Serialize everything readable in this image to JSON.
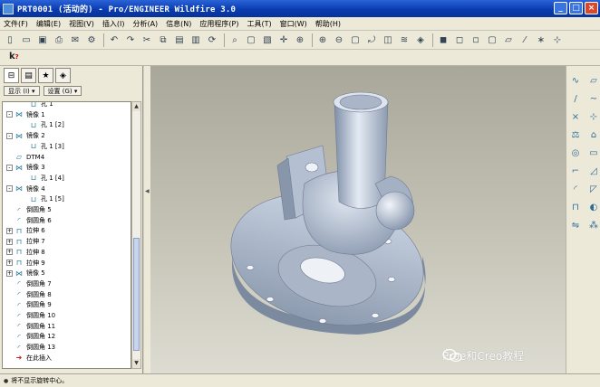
{
  "window": {
    "title": "PRT0001 (活动的) - Pro/ENGINEER Wildfire 3.0"
  },
  "menu": [
    "文件(F)",
    "编辑(E)",
    "视图(V)",
    "插入(I)",
    "分析(A)",
    "信息(N)",
    "应用程序(P)",
    "工具(T)",
    "窗口(W)",
    "帮助(H)"
  ],
  "toolbar_icons": [
    "new-file-icon",
    "open-folder-icon",
    "save-icon",
    "print-icon",
    "email-icon",
    "properties-icon",
    "undo-icon",
    "redo-icon",
    "cut-icon",
    "copy-icon",
    "paste-icon",
    "paste-special-icon",
    "regenerate-icon",
    "find-icon",
    "select-box-icon",
    "repaint-icon",
    "spin-center-icon",
    "orient-icon",
    "zoom-in-icon",
    "zoom-out-icon",
    "refit-icon",
    "reorient-icon",
    "saved-views-icon",
    "layers-icon",
    "view-manager-icon",
    "shading-icon",
    "hidden-line-icon",
    "no-hidden-icon",
    "wireframe-icon",
    "datum-planes-icon",
    "datum-axes-icon",
    "datum-points-icon",
    "csys-icon"
  ],
  "left_panel": {
    "show_button": "显示 (I) ▾",
    "settings_button": "设置 (G) ▾",
    "tree": [
      {
        "label": "孔 1",
        "indent": 2,
        "icon": "hole",
        "expander": ""
      },
      {
        "label": "镜像 1",
        "indent": 0,
        "icon": "mirror",
        "expander": "-"
      },
      {
        "label": "孔 1 [2]",
        "indent": 2,
        "icon": "hole",
        "expander": ""
      },
      {
        "label": "镜像 2",
        "indent": 0,
        "icon": "mirror",
        "expander": "-"
      },
      {
        "label": "孔 1 [3]",
        "indent": 2,
        "icon": "hole",
        "expander": ""
      },
      {
        "label": "DTM4",
        "indent": 0,
        "icon": "datum",
        "expander": ""
      },
      {
        "label": "镜像 3",
        "indent": 0,
        "icon": "mirror",
        "expander": "-"
      },
      {
        "label": "孔 1 [4]",
        "indent": 2,
        "icon": "hole",
        "expander": ""
      },
      {
        "label": "镜像 4",
        "indent": 0,
        "icon": "mirror",
        "expander": "-"
      },
      {
        "label": "孔 1 [5]",
        "indent": 2,
        "icon": "hole",
        "expander": ""
      },
      {
        "label": "倒圆角 5",
        "indent": 0,
        "icon": "round",
        "expander": ""
      },
      {
        "label": "倒圆角 6",
        "indent": 0,
        "icon": "round",
        "expander": ""
      },
      {
        "label": "拉伸 6",
        "indent": 0,
        "icon": "extrude",
        "expander": "+"
      },
      {
        "label": "拉伸 7",
        "indent": 0,
        "icon": "extrude",
        "expander": "+"
      },
      {
        "label": "拉伸 8",
        "indent": 0,
        "icon": "extrude",
        "expander": "+"
      },
      {
        "label": "拉伸 9",
        "indent": 0,
        "icon": "extrude",
        "expander": "+"
      },
      {
        "label": "镜像 5",
        "indent": 0,
        "icon": "mirror",
        "expander": "+"
      },
      {
        "label": "倒圆角 7",
        "indent": 0,
        "icon": "round",
        "expander": ""
      },
      {
        "label": "倒圆角 8",
        "indent": 0,
        "icon": "round",
        "expander": ""
      },
      {
        "label": "倒圆角 9",
        "indent": 0,
        "icon": "round",
        "expander": ""
      },
      {
        "label": "倒圆角 10",
        "indent": 0,
        "icon": "round",
        "expander": ""
      },
      {
        "label": "倒圆角 11",
        "indent": 0,
        "icon": "round",
        "expander": ""
      },
      {
        "label": "倒圆角 12",
        "indent": 0,
        "icon": "round",
        "expander": ""
      },
      {
        "label": "倒圆角 13",
        "indent": 0,
        "icon": "round",
        "expander": ""
      },
      {
        "label": "在此插入",
        "indent": 0,
        "icon": "insert",
        "expander": ""
      }
    ]
  },
  "right_toolbar_icons": [
    "sketch-icon",
    "plane-icon",
    "axis-icon",
    "curve-icon",
    "point-icon",
    "csys-icon",
    "analysis-icon",
    "feature-icon",
    "hole-icon",
    "shell-icon",
    "rib-icon",
    "draft-icon",
    "round-icon",
    "chamfer-icon",
    "extrude-icon",
    "revolve-icon",
    "mirror-icon",
    "pattern-icon"
  ],
  "status": {
    "message": "将不显示旋转中心。"
  },
  "watermark": {
    "text": "Proe和Creo教程"
  },
  "colors": {
    "titlebar": "#0a3cb0",
    "part": "#b9c7d9",
    "viewport_top": "#a9a79a",
    "viewport_bottom": "#dddcd2"
  }
}
